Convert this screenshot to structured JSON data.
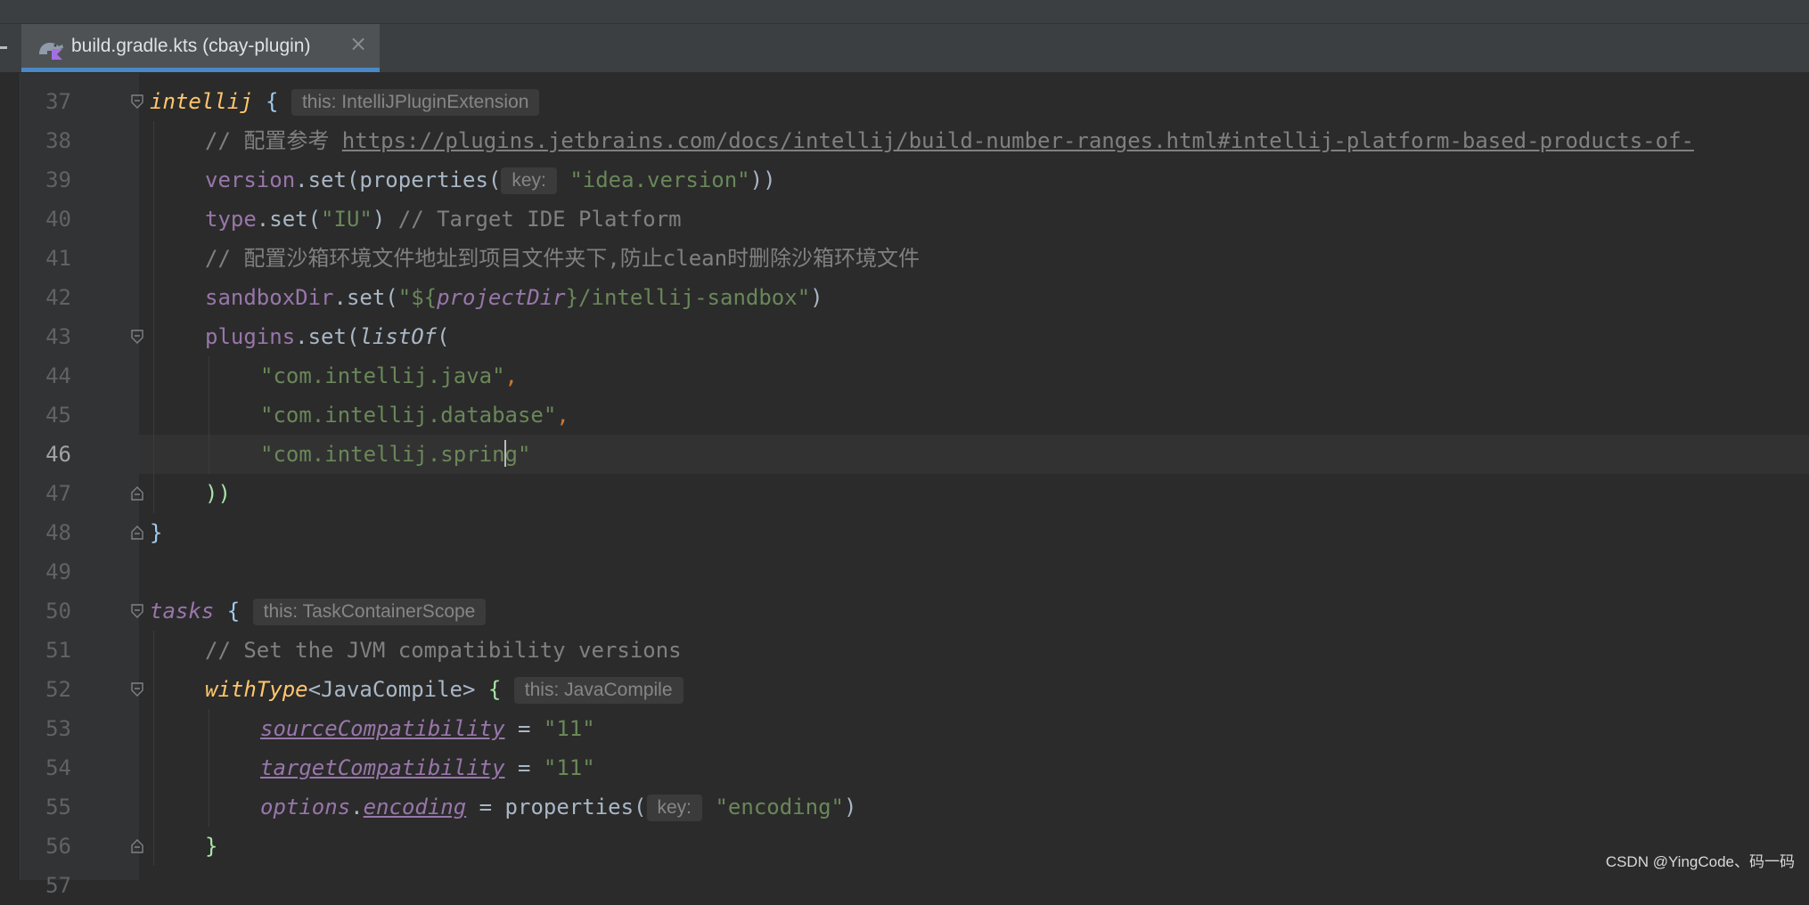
{
  "tab": {
    "title": "build.gradle.kts (cbay-plugin)",
    "file_icon": "gradle-kotlin-file-icon",
    "close_icon": "close-icon"
  },
  "editor": {
    "current_line": 46,
    "lines": [
      {
        "num": "37",
        "fold": "open",
        "indent": 0,
        "tokens": [
          {
            "t": "intellij",
            "c": "fn"
          },
          {
            "t": " "
          },
          {
            "t": "{",
            "c": "brace2"
          },
          {
            "t": " "
          },
          {
            "t": "this: IntelliJPluginExtension",
            "c": "hint"
          }
        ]
      },
      {
        "num": "38",
        "indent": 1,
        "tokens": [
          {
            "t": "// 配置参考 ",
            "c": "cmt"
          },
          {
            "t": "https://plugins.jetbrains.com/docs/intellij/build-number-ranges.html#intellij-platform-based-products-of-",
            "c": "url"
          }
        ]
      },
      {
        "num": "39",
        "indent": 1,
        "tokens": [
          {
            "t": "version",
            "c": "prop"
          },
          {
            "t": ".set("
          },
          {
            "t": "properties("
          },
          {
            "t": "key:",
            "c": "hint"
          },
          {
            "t": " "
          },
          {
            "t": "\"idea.version\"",
            "c": "str"
          },
          {
            "t": "))"
          }
        ]
      },
      {
        "num": "40",
        "indent": 1,
        "tokens": [
          {
            "t": "type",
            "c": "prop"
          },
          {
            "t": ".set("
          },
          {
            "t": "\"IU\"",
            "c": "str"
          },
          {
            "t": ") "
          },
          {
            "t": "// Target IDE Platform",
            "c": "cmt"
          }
        ]
      },
      {
        "num": "41",
        "indent": 1,
        "tokens": [
          {
            "t": "// 配置沙箱环境文件地址到项目文件夹下,防止clean时删除沙箱环境文件",
            "c": "cmt"
          }
        ]
      },
      {
        "num": "42",
        "indent": 1,
        "tokens": [
          {
            "t": "sandboxDir",
            "c": "prop"
          },
          {
            "t": ".set("
          },
          {
            "t": "\"${",
            "c": "str"
          },
          {
            "t": "projectDir",
            "c": "ext"
          },
          {
            "t": "}/intellij-sandbox\"",
            "c": "str"
          },
          {
            "t": ")"
          }
        ]
      },
      {
        "num": "43",
        "fold": "open",
        "indent": 1,
        "tokens": [
          {
            "t": "plugins",
            "c": "prop"
          },
          {
            "t": ".set("
          },
          {
            "t": "listOf",
            "c": "ital"
          },
          {
            "t": "("
          }
        ]
      },
      {
        "num": "44",
        "indent": 2,
        "tokens": [
          {
            "t": "\"com.intellij.java\"",
            "c": "str"
          },
          {
            "t": ",",
            "c": "kw"
          }
        ]
      },
      {
        "num": "45",
        "indent": 2,
        "tokens": [
          {
            "t": "\"com.intellij.database\"",
            "c": "str"
          },
          {
            "t": ",",
            "c": "kw"
          }
        ]
      },
      {
        "num": "46",
        "indent": 2,
        "tokens": [
          {
            "t": "\"com.intellij.sprin",
            "c": "str"
          },
          {
            "t": "",
            "c": "caret"
          },
          {
            "t": "g\"",
            "c": "str"
          }
        ]
      },
      {
        "num": "47",
        "fold": "close",
        "indent": 1,
        "tokens": [
          {
            "t": "))",
            "c": "brace3"
          }
        ]
      },
      {
        "num": "48",
        "fold": "close",
        "indent": 0,
        "tokens": [
          {
            "t": "}",
            "c": "brace2"
          }
        ]
      },
      {
        "num": "49",
        "indent": 0,
        "tokens": []
      },
      {
        "num": "50",
        "fold": "open",
        "indent": 0,
        "tokens": [
          {
            "t": "tasks",
            "c": "ext"
          },
          {
            "t": " "
          },
          {
            "t": "{",
            "c": "brace2"
          },
          {
            "t": " "
          },
          {
            "t": "this: TaskContainerScope",
            "c": "hint"
          }
        ]
      },
      {
        "num": "51",
        "indent": 1,
        "tokens": [
          {
            "t": "// Set the JVM compatibility versions",
            "c": "cmt"
          }
        ]
      },
      {
        "num": "52",
        "fold": "open",
        "indent": 1,
        "tokens": [
          {
            "t": "withType",
            "c": "fn"
          },
          {
            "t": "<JavaCompile> "
          },
          {
            "t": "{",
            "c": "brace3"
          },
          {
            "t": " "
          },
          {
            "t": "this: JavaCompile",
            "c": "hint"
          }
        ]
      },
      {
        "num": "53",
        "indent": 2,
        "tokens": [
          {
            "t": "sourceCompatibility",
            "c": "ext und"
          },
          {
            "t": " = "
          },
          {
            "t": "\"11\"",
            "c": "str"
          }
        ]
      },
      {
        "num": "54",
        "indent": 2,
        "tokens": [
          {
            "t": "targetCompatibility",
            "c": "ext und"
          },
          {
            "t": " = "
          },
          {
            "t": "\"11\"",
            "c": "str"
          }
        ]
      },
      {
        "num": "55",
        "indent": 2,
        "tokens": [
          {
            "t": "options",
            "c": "ext"
          },
          {
            "t": "."
          },
          {
            "t": "encoding",
            "c": "ext und"
          },
          {
            "t": " = properties("
          },
          {
            "t": "key:",
            "c": "hint"
          },
          {
            "t": " "
          },
          {
            "t": "\"encoding\"",
            "c": "str"
          },
          {
            "t": ")"
          }
        ]
      },
      {
        "num": "56",
        "fold": "close",
        "indent": 1,
        "tokens": [
          {
            "t": "}",
            "c": "brace3"
          }
        ]
      },
      {
        "num": "57",
        "indent": 0,
        "tokens": []
      }
    ]
  },
  "watermark": "CSDN @YingCode、码一码"
}
